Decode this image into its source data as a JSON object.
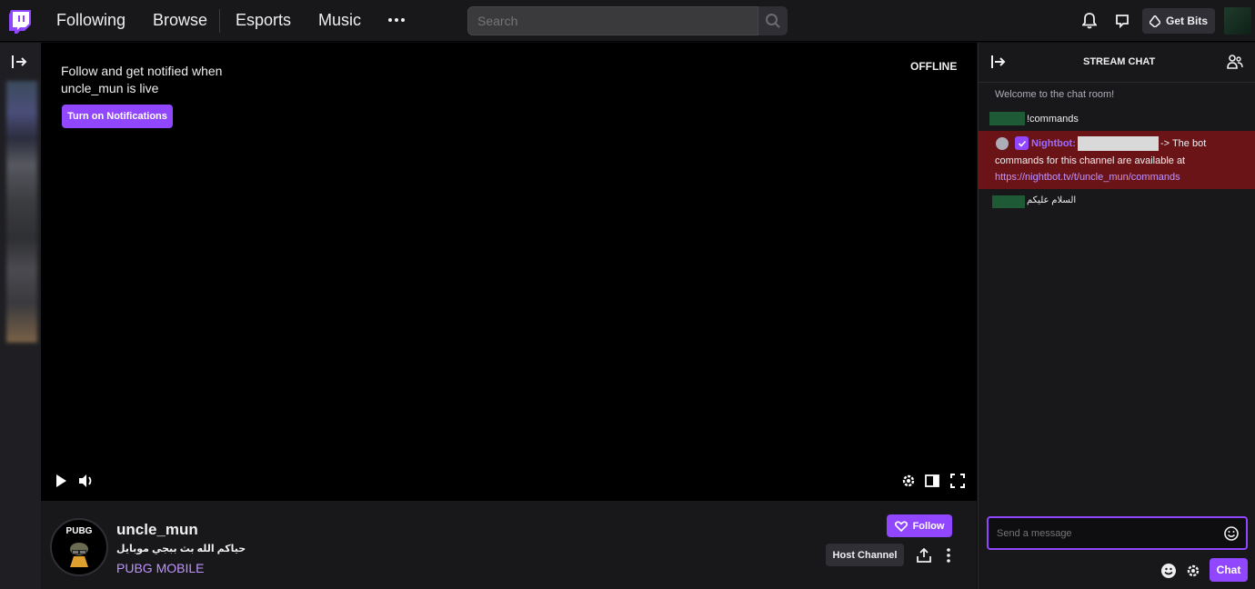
{
  "nav": {
    "links": [
      "Following",
      "Browse",
      "Esports",
      "Music"
    ],
    "search_placeholder": "Search",
    "get_bits_label": "Get Bits"
  },
  "player": {
    "offline_message": "Follow and get notified when uncle_mun is live",
    "notify_button": "Turn on Notifications",
    "status": "OFFLINE"
  },
  "channel": {
    "avatar_label": "PUBG",
    "name": "uncle_mun",
    "title": "حياكم الله بث ببجي موبايل",
    "game": "PUBG MOBILE",
    "follow_label": "Follow",
    "host_label": "Host Channel"
  },
  "chat": {
    "title": "STREAM CHAT",
    "welcome": "Welcome to the chat room!",
    "messages": [
      {
        "text": "!commands"
      },
      {
        "username": "Nightbot:",
        "text_line1": "-> The bot",
        "text_line2": "commands for this channel are available at",
        "link": "https://nightbot.tv/t/uncle_mun/commands"
      },
      {
        "text": "السلام عليكم"
      }
    ],
    "input_placeholder": "Send a message",
    "send_label": "Chat"
  },
  "colors": {
    "accent": "#9147ff",
    "highlight": "#6b1417",
    "link": "#bf94ff"
  }
}
